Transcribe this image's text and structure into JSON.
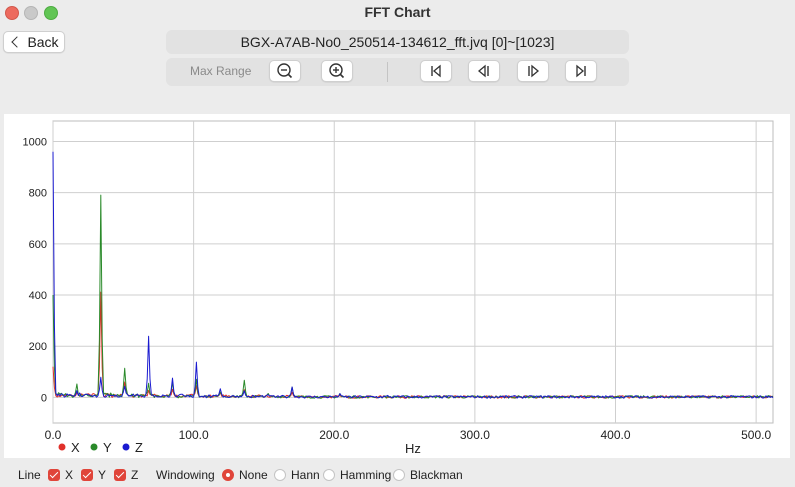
{
  "window": {
    "title": "FFT Chart"
  },
  "nav": {
    "back_label": "Back"
  },
  "file": {
    "title": "BGX-A7AB-No0_250514-134612_fft.jvq [0]~[1023]"
  },
  "toolbar": {
    "max_range_label": "Max Range",
    "buttons": [
      "zoom-out-icon",
      "zoom-in-icon",
      "skip-first-icon",
      "step-back-icon",
      "step-forward-icon",
      "skip-last-icon"
    ]
  },
  "bottom": {
    "line_label": "Line",
    "x_label": "X",
    "y_label": "Y",
    "z_label": "Z",
    "windowing_label": "Windowing",
    "none_label": "None",
    "hann_label": "Hann",
    "hamming_label": "Hamming",
    "blackman_label": "Blackman",
    "selected_window": "None"
  },
  "colors": {
    "x": "#e0302a",
    "y": "#2a8a2a",
    "z": "#1a1ad0",
    "accent": "#e0453a"
  },
  "chart_data": {
    "type": "line",
    "title": "",
    "xlabel": "Hz",
    "ylabel": "",
    "xlim": [
      0,
      512
    ],
    "ylim": [
      -100,
      1080
    ],
    "x_ticks": [
      0,
      100,
      200,
      300,
      400,
      500
    ],
    "x_tick_labels": [
      "0.0",
      "100.0",
      "200.0",
      "300.0",
      "400.0",
      "500.0"
    ],
    "y_ticks": [
      0,
      200,
      400,
      600,
      800,
      1000
    ],
    "y_tick_labels": [
      "0",
      "200",
      "400",
      "600",
      "800",
      "1000"
    ],
    "grid": true,
    "legend": [
      "X",
      "Y",
      "Z"
    ],
    "legend_placement": "bottom-left",
    "series": [
      {
        "name": "X",
        "color": "#e0302a",
        "peaks": [
          [
            0,
            120
          ],
          [
            17,
            15
          ],
          [
            34,
            400
          ],
          [
            51,
            60
          ],
          [
            68,
            20
          ],
          [
            85,
            30
          ],
          [
            102,
            40
          ],
          [
            119,
            15
          ],
          [
            136,
            30
          ],
          [
            170,
            20
          ],
          [
            204,
            8
          ]
        ]
      },
      {
        "name": "Y",
        "color": "#2a8a2a",
        "peaks": [
          [
            0,
            400
          ],
          [
            17,
            45
          ],
          [
            34,
            780
          ],
          [
            51,
            110
          ],
          [
            68,
            50
          ],
          [
            85,
            60
          ],
          [
            102,
            70
          ],
          [
            119,
            20
          ],
          [
            136,
            65
          ],
          [
            153,
            15
          ],
          [
            170,
            40
          ],
          [
            204,
            15
          ]
        ]
      },
      {
        "name": "Z",
        "color": "#1a1ad0",
        "peaks": [
          [
            0,
            960
          ],
          [
            17,
            20
          ],
          [
            34,
            70
          ],
          [
            51,
            40
          ],
          [
            68,
            230
          ],
          [
            85,
            75
          ],
          [
            102,
            135
          ],
          [
            119,
            30
          ],
          [
            136,
            25
          ],
          [
            153,
            10
          ],
          [
            170,
            40
          ],
          [
            204,
            15
          ],
          [
            238,
            8
          ],
          [
            272,
            5
          ]
        ]
      }
    ]
  }
}
